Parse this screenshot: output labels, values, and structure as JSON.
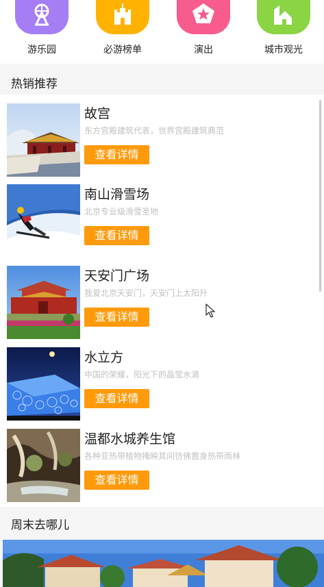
{
  "categories": [
    {
      "label": "游乐园",
      "icon": "ferris-wheel-icon",
      "color": "#a57ef6"
    },
    {
      "label": "必游榜单",
      "icon": "castle-icon",
      "color": "#ffb300"
    },
    {
      "label": "演出",
      "icon": "pentagon-star-icon",
      "color": "#f75c8d"
    },
    {
      "label": "城市观光",
      "icon": "city-building-icon",
      "color": "#8bd444"
    }
  ],
  "hot": {
    "title": "热销推荐",
    "items": [
      {
        "title": "故宫",
        "desc": "东方宫殿建筑代表，世界宫殿建筑典范",
        "button": "查看详情",
        "image": "forbidden-city-photo"
      },
      {
        "title": "南山滑雪场",
        "desc": "北京专业级滑雪圣地",
        "button": "查看详情",
        "image": "ski-resort-photo"
      },
      {
        "title": "天安门广场",
        "desc": "我爱北京天安门，天安门上太阳升",
        "button": "查看详情",
        "image": "tiananmen-photo"
      },
      {
        "title": "水立方",
        "desc": "中国的荣耀，阳光下的晶莹水滴",
        "button": "查看详情",
        "image": "water-cube-photo"
      },
      {
        "title": "温都水城养生馆",
        "desc": "各种亚热带植物掩映其间彷佛置身热带雨林",
        "button": "查看详情",
        "image": "hot-spring-photo"
      }
    ]
  },
  "weekend": {
    "title": "周末去哪儿",
    "image": "weekend-banner-photo"
  },
  "colors": {
    "button": "#ff9a0a",
    "desc_text": "#c0c0c0"
  }
}
